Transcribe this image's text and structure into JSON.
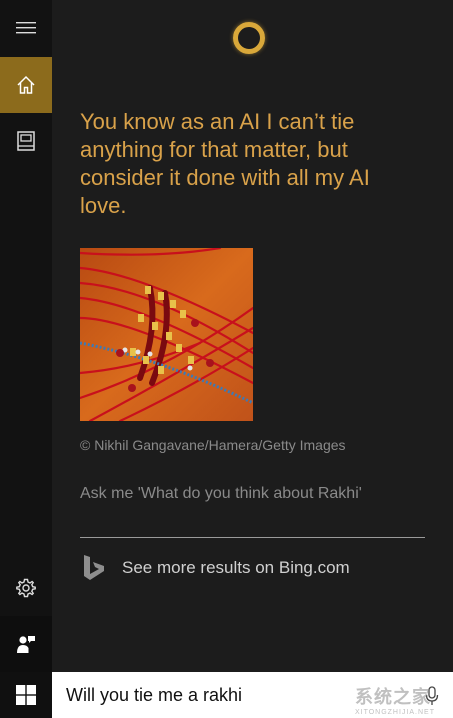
{
  "sidebar": {
    "menu_icon": "hamburger-icon",
    "items": [
      {
        "icon": "home-icon",
        "selected": true
      },
      {
        "icon": "notebook-icon",
        "selected": false
      }
    ],
    "bottom_items": [
      {
        "icon": "gear-icon"
      },
      {
        "icon": "feedback-icon"
      }
    ]
  },
  "cortana": {
    "icon": "cortana-ring-icon",
    "answer": "You know as an AI I can’t tie anything for that matter, but consider it done with all my AI love.",
    "image_credit": "© Nikhil Gangavane/Hamera/Getty Images",
    "suggestion": "Ask me 'What do you think about Rakhi'",
    "bing_link": "See more results on Bing.com"
  },
  "taskbar": {
    "start_icon": "windows-logo-icon",
    "search_query": "Will you tie me a rakhi",
    "mic_icon": "microphone-icon"
  },
  "watermark": {
    "text": "系统之家",
    "sub": "XITONGZHIJIA.NET"
  },
  "colors": {
    "accent": "#8c6b1c",
    "answer_text": "#d9a24a",
    "background": "#1c1c1c"
  }
}
